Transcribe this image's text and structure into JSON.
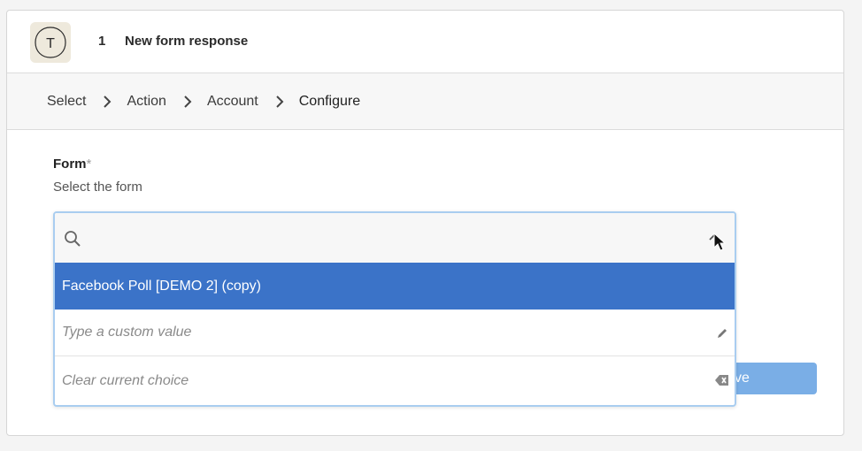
{
  "step": {
    "number": "1",
    "title": "New form response",
    "app_icon_letter": "T"
  },
  "breadcrumb": {
    "items": [
      "Select",
      "Action",
      "Account",
      "Configure"
    ]
  },
  "field": {
    "label": "Form",
    "required_mark": "*",
    "help": "Select the form"
  },
  "dropdown": {
    "search_placeholder": "",
    "selected_option": "Facebook Poll [DEMO 2] (copy)",
    "custom_value_placeholder": "Type a custom value",
    "clear_choice_label": "Clear current choice"
  },
  "continue_button": {
    "label": "ve"
  },
  "colors": {
    "selected_bg": "#3b73c8",
    "button_bg": "#7aaee6",
    "focus_border": "#a9cdf0"
  }
}
